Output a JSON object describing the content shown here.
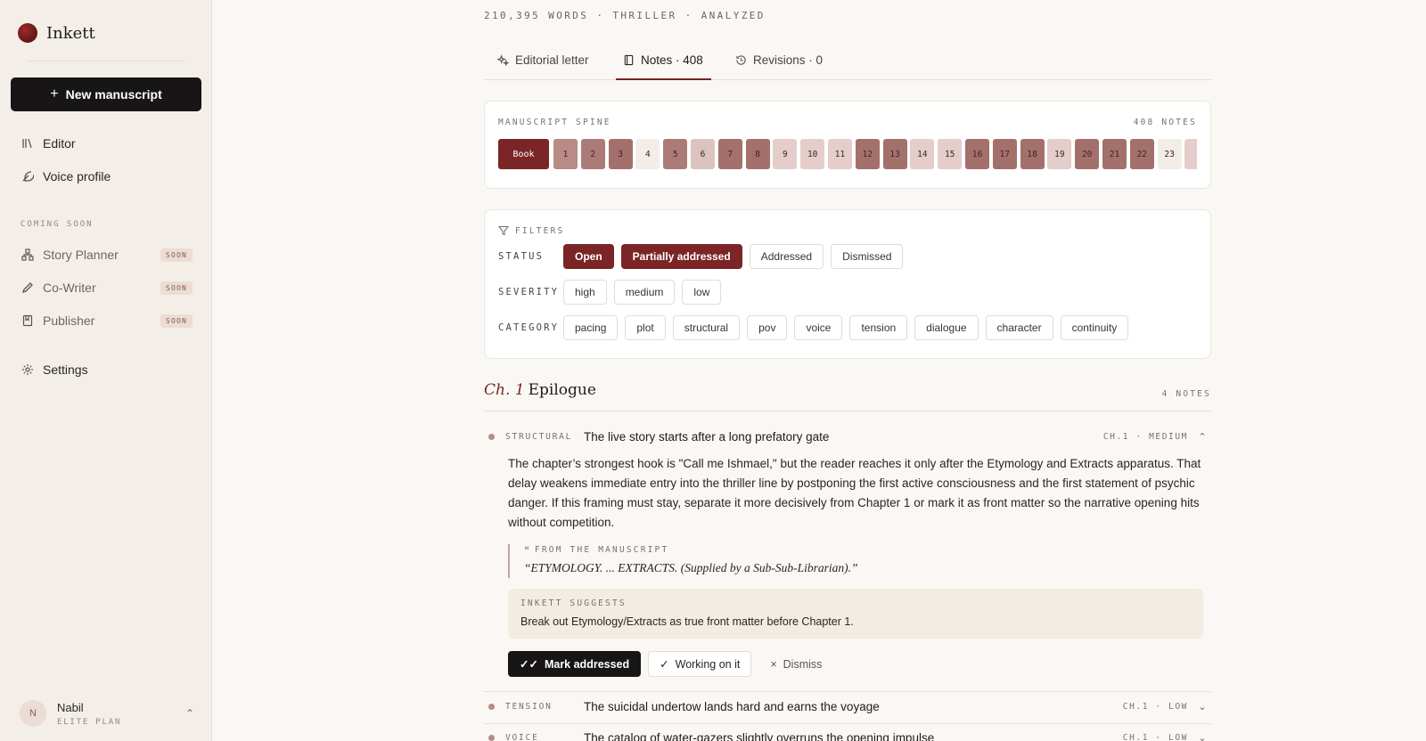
{
  "brand": {
    "name": "Inkett"
  },
  "sidebar": {
    "new_label": "New manuscript",
    "nav": [
      {
        "label": "Editor"
      },
      {
        "label": "Voice profile"
      }
    ],
    "section_label": "COMING SOON",
    "soon": [
      {
        "label": "Story Planner",
        "badge": "SOON"
      },
      {
        "label": "Co-Writer",
        "badge": "SOON"
      },
      {
        "label": "Publisher",
        "badge": "SOON"
      }
    ],
    "settings_label": "Settings",
    "user": {
      "initial": "N",
      "name": "Nabil",
      "plan": "ELITE PLAN"
    }
  },
  "manuscript": {
    "meta": "210,395 WORDS · THRILLER · ANALYZED"
  },
  "tabs": [
    {
      "label": "Editorial letter"
    },
    {
      "label": "Notes · 408"
    },
    {
      "label": "Revisions · 0"
    }
  ],
  "spine": {
    "title": "MANUSCRIPT SPINE",
    "count": "408 NOTES",
    "book_label": "Book",
    "cells": [
      {
        "n": "1",
        "c": "#b98a86"
      },
      {
        "n": "2",
        "c": "#ad7b77"
      },
      {
        "n": "3",
        "c": "#a4706c"
      },
      {
        "n": "4",
        "c": "#f2ede6"
      },
      {
        "n": "5",
        "c": "#ad7b77"
      },
      {
        "n": "6",
        "c": "#ddc3c0"
      },
      {
        "n": "7",
        "c": "#a4706c"
      },
      {
        "n": "8",
        "c": "#a4706c"
      },
      {
        "n": "9",
        "c": "#e4cdca"
      },
      {
        "n": "10",
        "c": "#e4cdca"
      },
      {
        "n": "11",
        "c": "#e4cdca"
      },
      {
        "n": "12",
        "c": "#a4706c"
      },
      {
        "n": "13",
        "c": "#a4706c"
      },
      {
        "n": "14",
        "c": "#e4cdca"
      },
      {
        "n": "15",
        "c": "#e4cdca"
      },
      {
        "n": "16",
        "c": "#a4706c"
      },
      {
        "n": "17",
        "c": "#a4706c"
      },
      {
        "n": "18",
        "c": "#a4706c"
      },
      {
        "n": "19",
        "c": "#e4cdca"
      },
      {
        "n": "20",
        "c": "#a4706c"
      },
      {
        "n": "21",
        "c": "#a4706c"
      },
      {
        "n": "22",
        "c": "#a4706c"
      },
      {
        "n": "23",
        "c": "#f2ede6"
      },
      {
        "n": "",
        "c": "#e4cdca"
      }
    ]
  },
  "filters": {
    "title": "FILTERS",
    "status_label": "STATUS",
    "status": [
      {
        "label": "Open",
        "on": true
      },
      {
        "label": "Partially addressed",
        "on": true
      },
      {
        "label": "Addressed",
        "on": false
      },
      {
        "label": "Dismissed",
        "on": false
      }
    ],
    "severity_label": "SEVERITY",
    "severity": [
      "high",
      "medium",
      "low"
    ],
    "category_label": "CATEGORY",
    "category": [
      "pacing",
      "plot",
      "structural",
      "pov",
      "voice",
      "tension",
      "dialogue",
      "character",
      "continuity"
    ]
  },
  "chapter": {
    "num": "Ch. 1",
    "name": "Epilogue",
    "count": "4 NOTES",
    "notes": [
      {
        "category": "STRUCTURAL",
        "title": "The live story starts after a long prefatory gate",
        "meta": "CH.1 · MEDIUM",
        "body": "The chapter’s strongest hook is \"Call me Ishmael,\" but the reader reaches it only after the Etymology and Extracts apparatus. That delay weakens immediate entry into the thriller line by postponing the first active consciousness and the first statement of psychic danger. If this framing must stay, separate it more decisively from Chapter 1 or mark it as front matter so the narrative opening hits without competition.",
        "quote_label": "FROM THE MANUSCRIPT",
        "quote": "“ETYMOLOGY. ... EXTRACTS. (Supplied by a Sub-Sub-Librarian).”",
        "suggest_label": "INKETT SUGGESTS",
        "suggest": "Break out Etymology/Extracts as true front matter before Chapter 1.",
        "actions": {
          "mark": "Mark addressed",
          "working": "Working on it",
          "dismiss": "Dismiss"
        }
      },
      {
        "category": "TENSION",
        "title": "The suicidal undertow lands hard and earns the voyage",
        "meta": "CH.1 · LOW"
      },
      {
        "category": "VOICE",
        "title": "The catalog of water-gazers slightly overruns the opening impulse",
        "meta": "CH.1 · LOW"
      }
    ]
  }
}
